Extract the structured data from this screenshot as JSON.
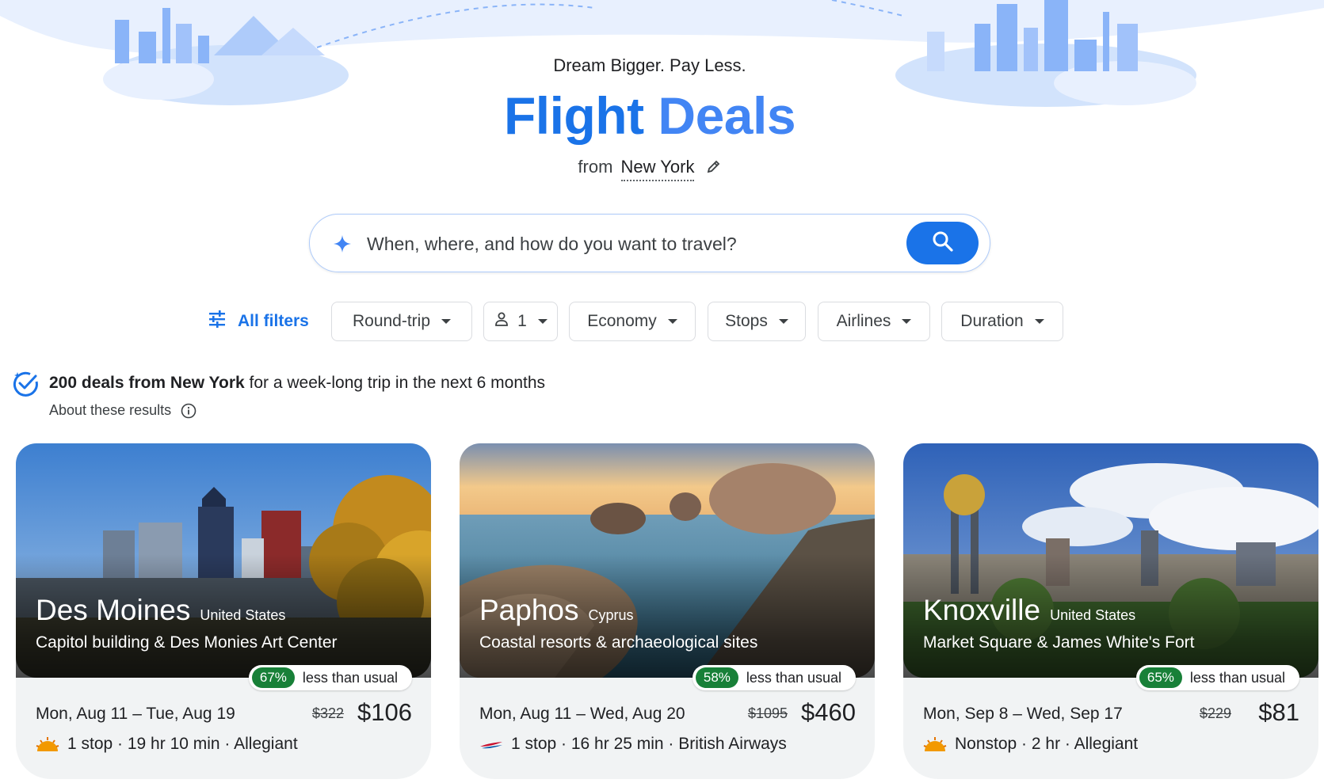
{
  "header": {
    "tagline": "Dream Bigger. Pay Less.",
    "title_part1": "Flight",
    "title_part2": "Deals",
    "from_label": "from",
    "from_city": "New York"
  },
  "search": {
    "placeholder": "When, where, and how do you want to travel?"
  },
  "filters": {
    "all_filters_label": "All filters",
    "trip_type": "Round-trip",
    "passengers": "1",
    "cabin": "Economy",
    "stops": "Stops",
    "airlines": "Airlines",
    "duration": "Duration"
  },
  "summary": {
    "count_text": "200 deals from New York",
    "rest_text": "for a week-long trip in the next 6 months",
    "about_label": "About these results"
  },
  "deals": [
    {
      "city": "Des Moines",
      "country": "United States",
      "description": "Capitol building & Des Monies Art Center",
      "discount": "67%",
      "discount_label": "less than usual",
      "dates": "Mon, Aug 11 – Tue, Aug 19",
      "old_price": "$322",
      "price": "$106",
      "details": "1 stop · 19 hr 10 min · Allegiant",
      "airline_logo": "allegiant-sun-icon"
    },
    {
      "city": "Paphos",
      "country": "Cyprus",
      "description": "Coastal resorts & archaeological sites",
      "discount": "58%",
      "discount_label": "less than usual",
      "dates": "Mon, Aug 11 – Wed, Aug 20",
      "old_price": "$1095",
      "price": "$460",
      "details": "1 stop · 16 hr 25 min · British Airways",
      "airline_logo": "british-airways-speedmarque-icon"
    },
    {
      "city": "Knoxville",
      "country": "United States",
      "description": "Market Square & James White's Fort",
      "discount": "65%",
      "discount_label": "less than usual",
      "dates": "Mon, Sep 8 – Wed, Sep 17",
      "old_price": "$229",
      "price": "$81",
      "details": "Nonstop · 2 hr · Allegiant",
      "airline_logo": "allegiant-sun-icon"
    }
  ],
  "colors": {
    "brand_blue": "#1a73e8",
    "discount_green": "#188038",
    "hero_light_blue": "#d2e3fc"
  }
}
